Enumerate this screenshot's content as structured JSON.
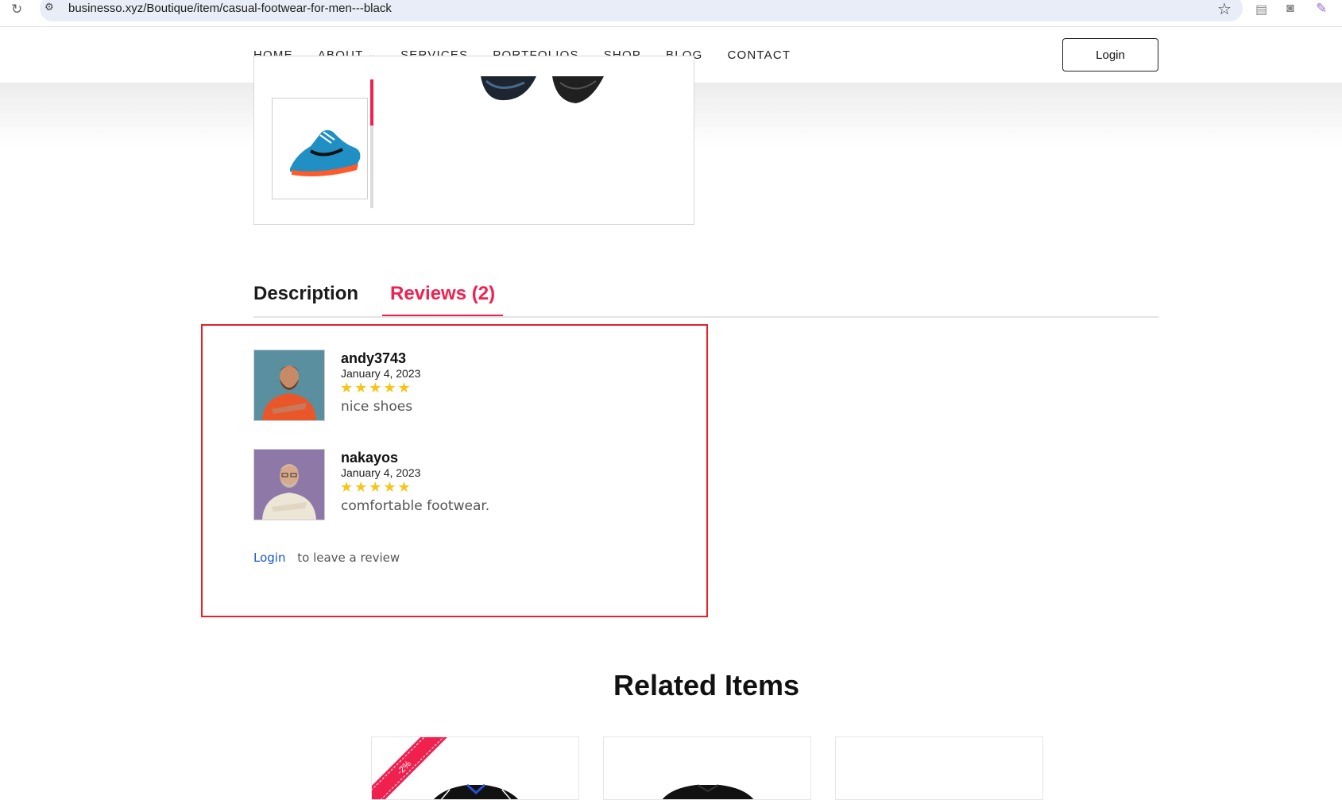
{
  "browser": {
    "url": "businesso.xyz/Boutique/item/casual-footwear-for-men---black"
  },
  "nav": {
    "items": [
      {
        "label": "HOME"
      },
      {
        "label": "ABOUT"
      },
      {
        "label": "SERVICES"
      },
      {
        "label": "PORTFOLIOS"
      },
      {
        "label": "SHOP"
      },
      {
        "label": "BLOG"
      },
      {
        "label": "CONTACT"
      }
    ],
    "login_label": "Login"
  },
  "tabs": {
    "description": "Description",
    "reviews": "Reviews (2)"
  },
  "reviews": [
    {
      "name": "andy3743",
      "date": "January 4, 2023",
      "rating": 5,
      "stars": "★★★★★",
      "text": "nice shoes"
    },
    {
      "name": "nakayos",
      "date": "January 4, 2023",
      "rating": 5,
      "stars": "★★★★★",
      "text": "comfortable footwear."
    }
  ],
  "review_prompt": {
    "link": "Login",
    "text": "to leave a review"
  },
  "related": {
    "title": "Related Items",
    "badge": "-2%"
  },
  "colors": {
    "accent": "#f0214f",
    "highlight": "#e8202a",
    "star": "#f5c518",
    "link": "#1a56c9"
  }
}
